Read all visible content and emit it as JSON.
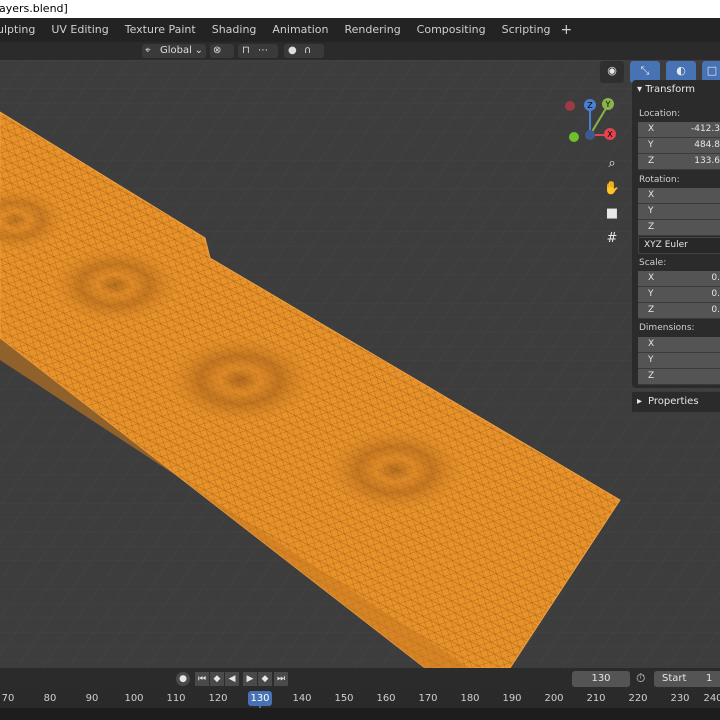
{
  "window": {
    "title": "ayers.blend]"
  },
  "workspaces": {
    "tabs": [
      "ulpting",
      "UV Editing",
      "Texture Paint",
      "Shading",
      "Animation",
      "Rendering",
      "Compositing",
      "Scripting"
    ],
    "add_label": "+"
  },
  "header": {
    "orientation": "Global"
  },
  "npanel": {
    "section_title": "Transform",
    "location_label": "Location:",
    "location": [
      {
        "axis": "X",
        "value": "-412.3"
      },
      {
        "axis": "Y",
        "value": "484.8"
      },
      {
        "axis": "Z",
        "value": "133.6"
      }
    ],
    "rotation_label": "Rotation:",
    "rotation": [
      {
        "axis": "X",
        "value": ""
      },
      {
        "axis": "Y",
        "value": ""
      },
      {
        "axis": "Z",
        "value": ""
      }
    ],
    "rotation_mode": "XYZ Euler",
    "scale_label": "Scale:",
    "scale": [
      {
        "axis": "X",
        "value": "0."
      },
      {
        "axis": "Y",
        "value": "0."
      },
      {
        "axis": "Z",
        "value": "0."
      }
    ],
    "dimensions_label": "Dimensions:",
    "dimensions": [
      {
        "axis": "X",
        "value": ""
      },
      {
        "axis": "Y",
        "value": ""
      },
      {
        "axis": "Z",
        "value": ""
      }
    ],
    "properties_label": "Properties"
  },
  "gizmo": {
    "x_label": "X",
    "y_label": "Y",
    "z_label": "Z"
  },
  "timeline": {
    "current_frame": "130",
    "start_label": "Start",
    "start_value": "1",
    "ticks": [
      "70",
      "80",
      "90",
      "100",
      "110",
      "120",
      "130",
      "140",
      "150",
      "160",
      "170",
      "180",
      "190",
      "200",
      "210",
      "220",
      "230",
      "240"
    ],
    "marker": "130"
  },
  "colors": {
    "selection": "#e8932a",
    "accent": "#4772b3"
  },
  "icons": [
    "cursor-icon",
    "snap-icon",
    "proportional-icon",
    "zoom-icon",
    "hand-icon",
    "camera-icon",
    "grid-icon",
    "visibility-icon",
    "overlay-icon",
    "xray-icon",
    "record-icon",
    "play-icon",
    "stopwatch-icon"
  ]
}
